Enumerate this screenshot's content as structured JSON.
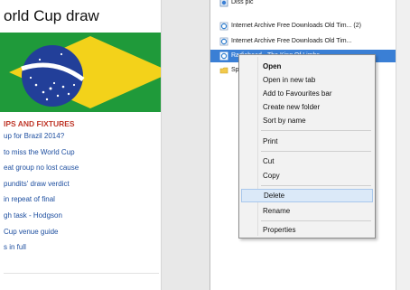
{
  "web": {
    "headline": "orld Cup draw",
    "section_heading": "IPS AND FIXTURES",
    "news_items": [
      "up for Brazil 2014?",
      "to miss the World Cup",
      "eat group no lost cause",
      "pundits' draw verdict",
      "in repeat of final",
      "gh task - Hodgson",
      "Cup venue guide",
      "s in full"
    ],
    "flag_colors": {
      "green": "#1f9a3a",
      "yellow": "#f3d21a",
      "blue": "#223f99",
      "band": "#ffffff"
    }
  },
  "explorer": {
    "files": [
      {
        "name": "Diss pic",
        "icon": "image-file-icon"
      },
      {
        "name": "Internet Archive Free Downloads Old Tim... (2)",
        "icon": "web-shortcut-icon"
      },
      {
        "name": "Internet Archive Free Downloads Old Tim...",
        "icon": "web-shortcut-icon"
      },
      {
        "name": "Radiohead - The King Of Limbs",
        "icon": "web-shortcut-icon",
        "selected": true
      },
      {
        "name": "Sp",
        "icon": "folder-icon"
      }
    ],
    "selection_color": "#3a7fd5"
  },
  "context_menu": {
    "items": {
      "open": "Open",
      "open_new_tab": "Open in new tab",
      "add_favourites": "Add to Favourites bar",
      "create_folder": "Create new folder",
      "sort_by_name": "Sort by name",
      "print": "Print",
      "cut": "Cut",
      "copy": "Copy",
      "delete": "Delete",
      "rename": "Rename",
      "properties": "Properties"
    },
    "highlighted": "delete",
    "highlight_color": "#dbe9f8"
  }
}
